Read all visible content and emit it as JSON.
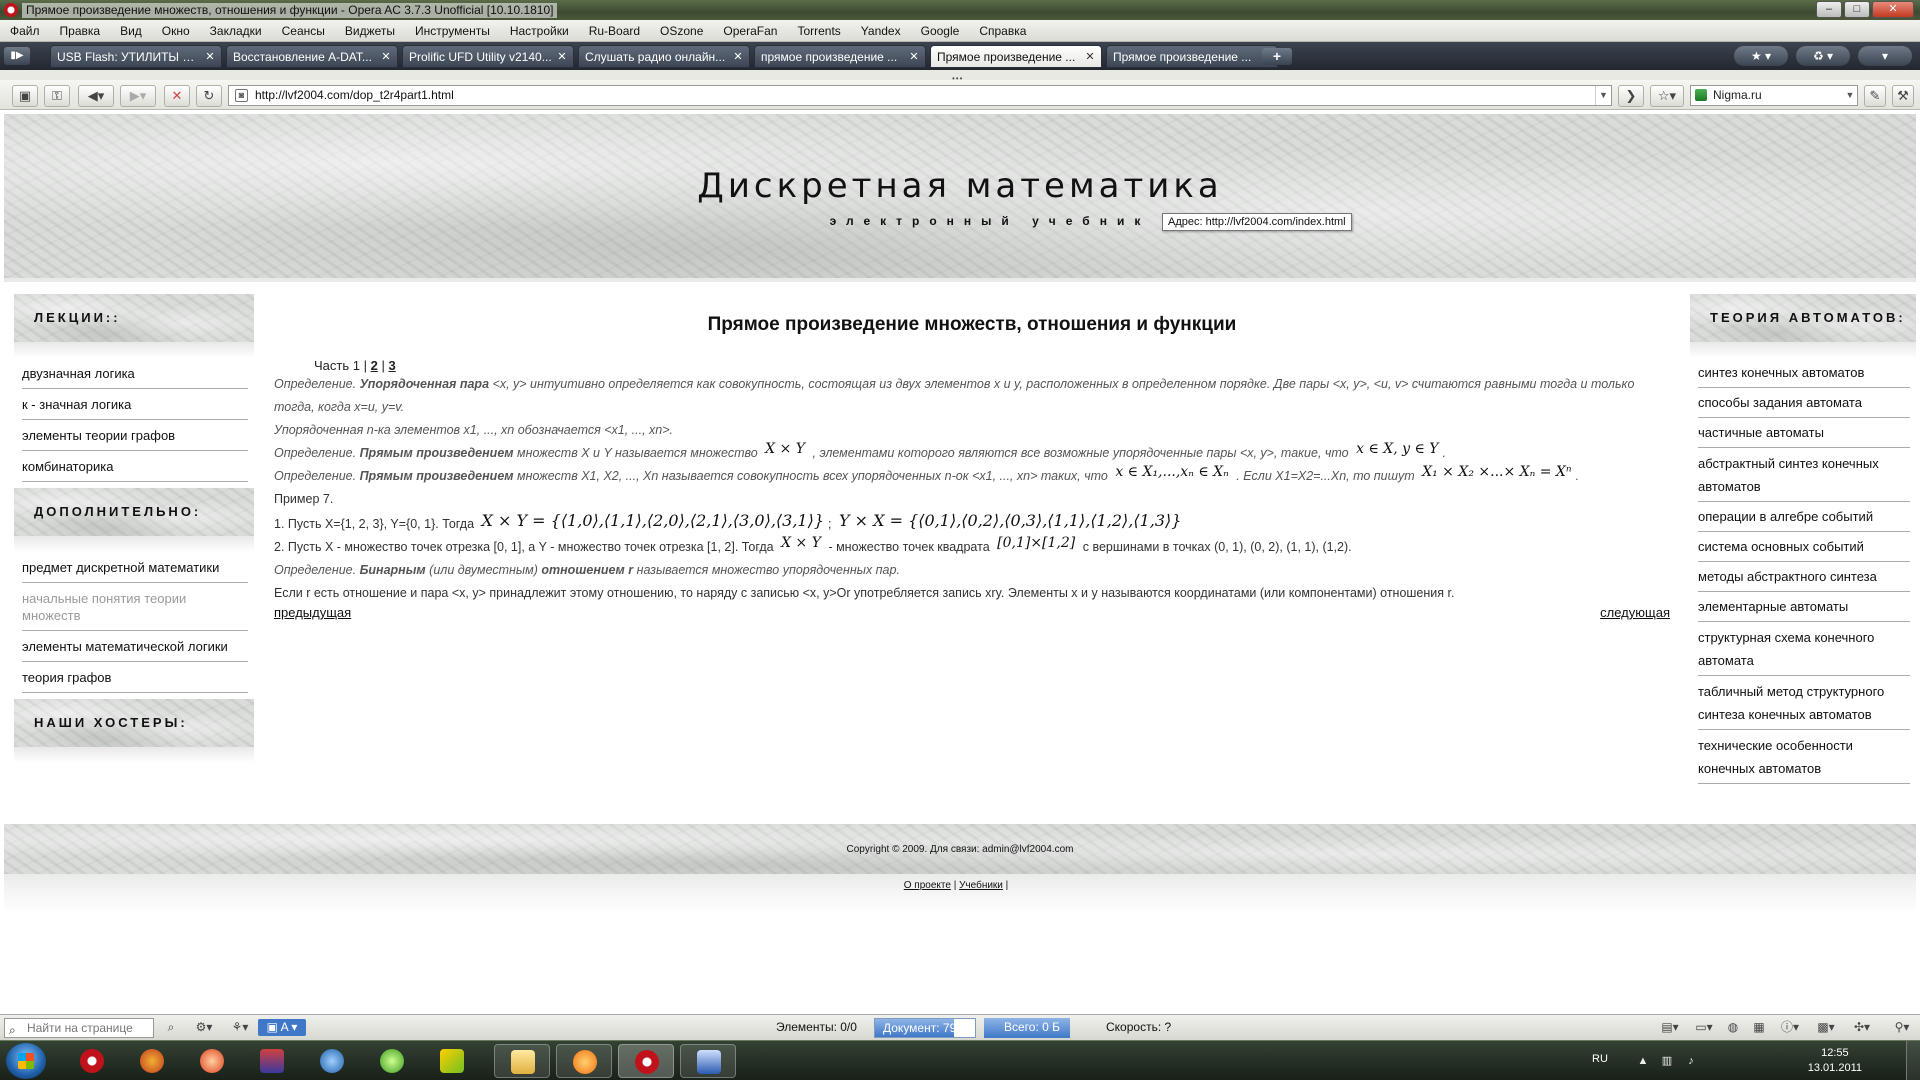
{
  "window": {
    "title": "Прямое произведение множеств, отношения и функции - Opera AC 3.7.3 Unofficial [10.10.1810]"
  },
  "menu": [
    "Файл",
    "Правка",
    "Вид",
    "Окно",
    "Закладки",
    "Сеансы",
    "Виджеты",
    "Инструменты",
    "Настройки",
    "Ru-Board",
    "OSzone",
    "OperaFan",
    "Torrents",
    "Yandex",
    "Google",
    "Справка"
  ],
  "tabs": [
    {
      "label": "USB Flash: УТИЛИТЫ дл..."
    },
    {
      "label": "Восстановление A-DAT..."
    },
    {
      "label": "Prolific UFD Utility v2140..."
    },
    {
      "label": "Слушать радио онлайн..."
    },
    {
      "label": "прямое произведение ..."
    },
    {
      "label": "Прямое произведение ..."
    },
    {
      "label": "Прямое произведение ..."
    }
  ],
  "address": {
    "url": "http://lvf2004.com/dop_t2r4part1.html",
    "search_engine": "Nigma.ru"
  },
  "header": {
    "title": "Дискретная математика",
    "subtitle": "электронный учебник",
    "tooltip": "Адрес: http://lvf2004.com/index.html"
  },
  "left_sidebar": {
    "lectures_head": "ЛЕКЦИИ::",
    "lectures": [
      "двузначная логика",
      "к - значная логика",
      "элементы теории графов",
      "комбинаторика"
    ],
    "extra_head": "ДОПОЛНИТЕЛЬНО:",
    "extra": [
      "предмет дискретной математики",
      "начальные понятия теории множеств",
      "элементы математической логики",
      "теория графов"
    ],
    "hosters_head": "НАШИ ХОСТЕРЫ:"
  },
  "right_sidebar": {
    "head": "ТЕОРИЯ АВТОМАТОВ:",
    "items": [
      "синтез конечных автоматов",
      "способы задания автомата",
      "частичные автоматы",
      "абстрактный синтез конечных автоматов",
      "операции в алгебре событий",
      "система основных событий",
      "методы абстрактного синтеза",
      "элементарные автоматы",
      "структурная схема конечного автомата",
      "табличный метод структурного синтеза конечных автоматов",
      "технические особенности конечных автоматов"
    ]
  },
  "main": {
    "title": "Прямое произведение множеств, отношения и функции",
    "pager": {
      "part_label": "Часть 1",
      "sep": "|",
      "p2": "2",
      "p3": "3"
    },
    "def1_prefix": "Определение.",
    "def1_term": "Упорядоченная пара",
    "def1_text": "<x, y> интуитивно определяется как совокупность, состоящая из двух элементов x и y, расположенных в определенном порядке. Две пары <x, y>, <u, v> считаются равными тогда и только тогда, когда x=u, y=v.",
    "ntuple": "Упорядоченная n-ка элементов x1, ..., xn обозначается <x1, ..., xn>.",
    "def2_prefix": "Определение.",
    "def2_term": "Прямым произведением",
    "def2_text": "множеств X и Y называется множество",
    "def2_math": "X × Y",
    "def2_text2": ", элементами которого являются все возможные упорядоченные пары <x, y>, такие, что",
    "def2_math2": "x ∈ X, y ∈ Y",
    "def3_prefix": "Определение.",
    "def3_term": "Прямым произведением",
    "def3_text": "множеств X1, X2, ..., Xn называется совокупность всех упорядоченных n-ок <x1, ..., xn> таких, что",
    "def3_math": "x ∈ X₁,...,xₙ ∈ Xₙ",
    "def3_text2": ". Если X1=X2=...Xn, то пишут",
    "def3_math2": "X₁ × X₂ ×...× Xₙ = Xⁿ",
    "example": "Пример 7.",
    "ex1_text": "1. Пусть X={1, 2, 3}, Y={0, 1}. Тогда",
    "ex1_math": "X × Y = {⟨1,0⟩,⟨1,1⟩,⟨2,0⟩,⟨2,1⟩,⟨3,0⟩,⟨3,1⟩}",
    "ex1_math2": "Y × X = {⟨0,1⟩,⟨0,2⟩,⟨0,3⟩,⟨1,1⟩,⟨1,2⟩,⟨1,3⟩}",
    "ex2_text": "2. Пусть X - множество точек отрезка [0, 1], а Y - множество точек отрезка [1, 2]. Тогда",
    "ex2_math": "X × Y",
    "ex2_text2": "- множество точек квадрата",
    "ex2_math2": "[0,1]×[1,2]",
    "ex2_text3": "с вершинами в точках (0, 1), (0, 2), (1, 1), (1,2).",
    "def4_prefix": "Определение.",
    "def4_term": "Бинарным",
    "def4_mid": "(или двуместным)",
    "def4_term2": "отношением r",
    "def4_text": "называется множество упорядоченных пар.",
    "rel_text": "Если r есть отношение и пара <x, y> принадлежит этому отношению, то наряду с записью <x, y>Оr употребляется запись xry. Элементы x и y называются координатами (или компонентами) отношения r.",
    "prev": "предыдущая",
    "next": "следующая"
  },
  "footer": {
    "copyright": "Copyright © 2009. Для связи: admin@lvf2004.com",
    "about": "О проекте",
    "sep": "|",
    "textbooks": "Учебники",
    "sep2": "|"
  },
  "statusbar": {
    "find_placeholder": "Найти на странице",
    "elements": "Элементы:  0/0",
    "document": "Документ:  79%",
    "document_progress": 0.79,
    "total": "Всего:  0 Б",
    "speed": "Скорость:  ?"
  },
  "taskbar": {
    "lang": "RU",
    "time": "12:55",
    "date": "13.01.2011"
  }
}
